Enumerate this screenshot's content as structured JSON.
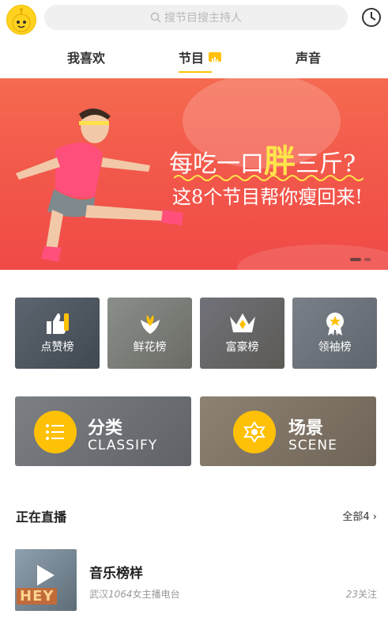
{
  "search": {
    "placeholder": "搜节目搜主持人"
  },
  "tabs": [
    {
      "label": "我喜欢"
    },
    {
      "label": "节目"
    },
    {
      "label": "声音"
    }
  ],
  "banner": {
    "line1_a": "每吃一口",
    "line1_hl": "胖",
    "line1_b": "三斤?",
    "line2": "这8个节目帮你瘦回来!"
  },
  "rankings": [
    {
      "label": "点赞榜",
      "icon": "thumbs-up-icon"
    },
    {
      "label": "鲜花榜",
      "icon": "flower-icon"
    },
    {
      "label": "富豪榜",
      "icon": "crown-icon"
    },
    {
      "label": "领袖榜",
      "icon": "medal-icon"
    }
  ],
  "categories": [
    {
      "cn": "分类",
      "en": "CLASSIFY",
      "icon": "list-icon"
    },
    {
      "cn": "场景",
      "en": "SCENE",
      "icon": "scene-icon"
    }
  ],
  "live": {
    "heading": "正在直播",
    "all": "全部4",
    "item": {
      "title": "音乐榜样",
      "sub_prefix": "武汉",
      "sub_num": "1064",
      "sub_suffix": "女主播电台",
      "fans_num": "23",
      "fans_suffix": "关注",
      "thumb_text": "HEY"
    }
  },
  "colors": {
    "accent": "#ffc107",
    "banner": "#f2564a"
  }
}
